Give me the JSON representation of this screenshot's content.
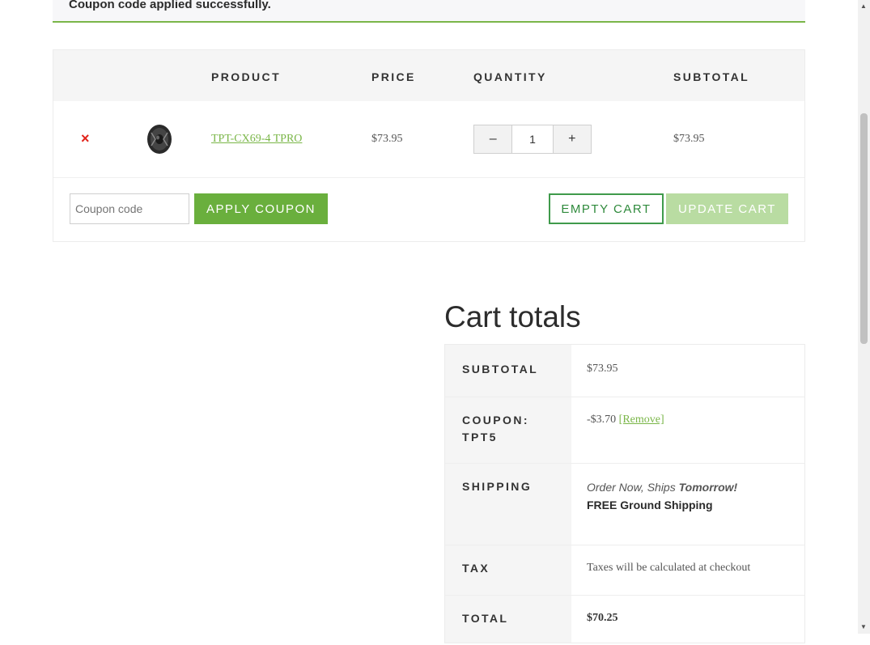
{
  "notice": {
    "text": "Coupon code applied successfully."
  },
  "table": {
    "headers": {
      "product": "PRODUCT",
      "price": "PRICE",
      "quantity": "QUANTITY",
      "subtotal": "SUBTOTAL"
    },
    "items": [
      {
        "remove": "×",
        "name": "TPT-CX69-4 TPRO",
        "price": "$73.95",
        "quantity": "1",
        "subtotal": "$73.95"
      }
    ],
    "qty_minus": "–",
    "qty_plus": "+"
  },
  "actions": {
    "coupon_placeholder": "Coupon code",
    "apply_label": "APPLY COUPON",
    "empty_label": "EMPTY CART",
    "update_label": "UPDATE CART"
  },
  "totals": {
    "title": "Cart totals",
    "subtotal_label": "SUBTOTAL",
    "subtotal_value": "$73.95",
    "coupon_label": "COUPON: TPT5",
    "coupon_value": "-$3.70",
    "coupon_remove": "[Remove]",
    "shipping_label": "SHIPPING",
    "shipping_line1_a": "Order Now, Ships ",
    "shipping_line1_b": "Tomorrow!",
    "shipping_line2": "FREE Ground Shipping",
    "tax_label": "TAX",
    "tax_value": "Taxes will be calculated at checkout",
    "total_label": "TOTAL",
    "total_value": "$70.25"
  },
  "colors": {
    "accent": "#7ab648",
    "apply_button": "#6aaf3d",
    "update_button_disabled": "#b9dca2",
    "remove": "#e2231a"
  },
  "icons": {
    "remove": "close-icon",
    "product_thumb": "speaker-icon"
  }
}
